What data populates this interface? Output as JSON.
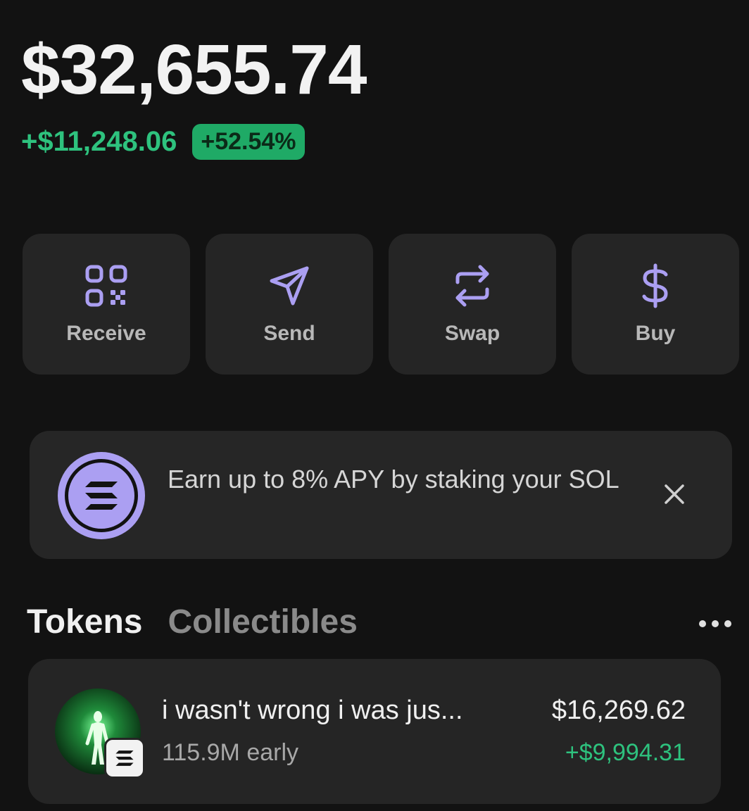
{
  "wallet": {
    "balance": "$32,655.74",
    "change_amount": "+$11,248.06",
    "change_percent": "+52.54%"
  },
  "actions": [
    {
      "label": "Receive",
      "icon": "qr-code-icon"
    },
    {
      "label": "Send",
      "icon": "send-icon"
    },
    {
      "label": "Swap",
      "icon": "swap-icon"
    },
    {
      "label": "Buy",
      "icon": "dollar-icon"
    }
  ],
  "banner": {
    "text": "Earn up to 8% APY by staking your SOL",
    "icon": "solana-icon"
  },
  "tabs": {
    "active": "Tokens",
    "inactive": "Collectibles"
  },
  "tokens": [
    {
      "name": "i wasn't wrong i was jus...",
      "subtitle": "115.9M early",
      "value": "$16,269.62",
      "change": "+$9,994.31"
    }
  ],
  "colors": {
    "background": "#121212",
    "accent_purple": "#ab9ff2",
    "positive_green": "#2ec27e",
    "card": "#252525"
  }
}
